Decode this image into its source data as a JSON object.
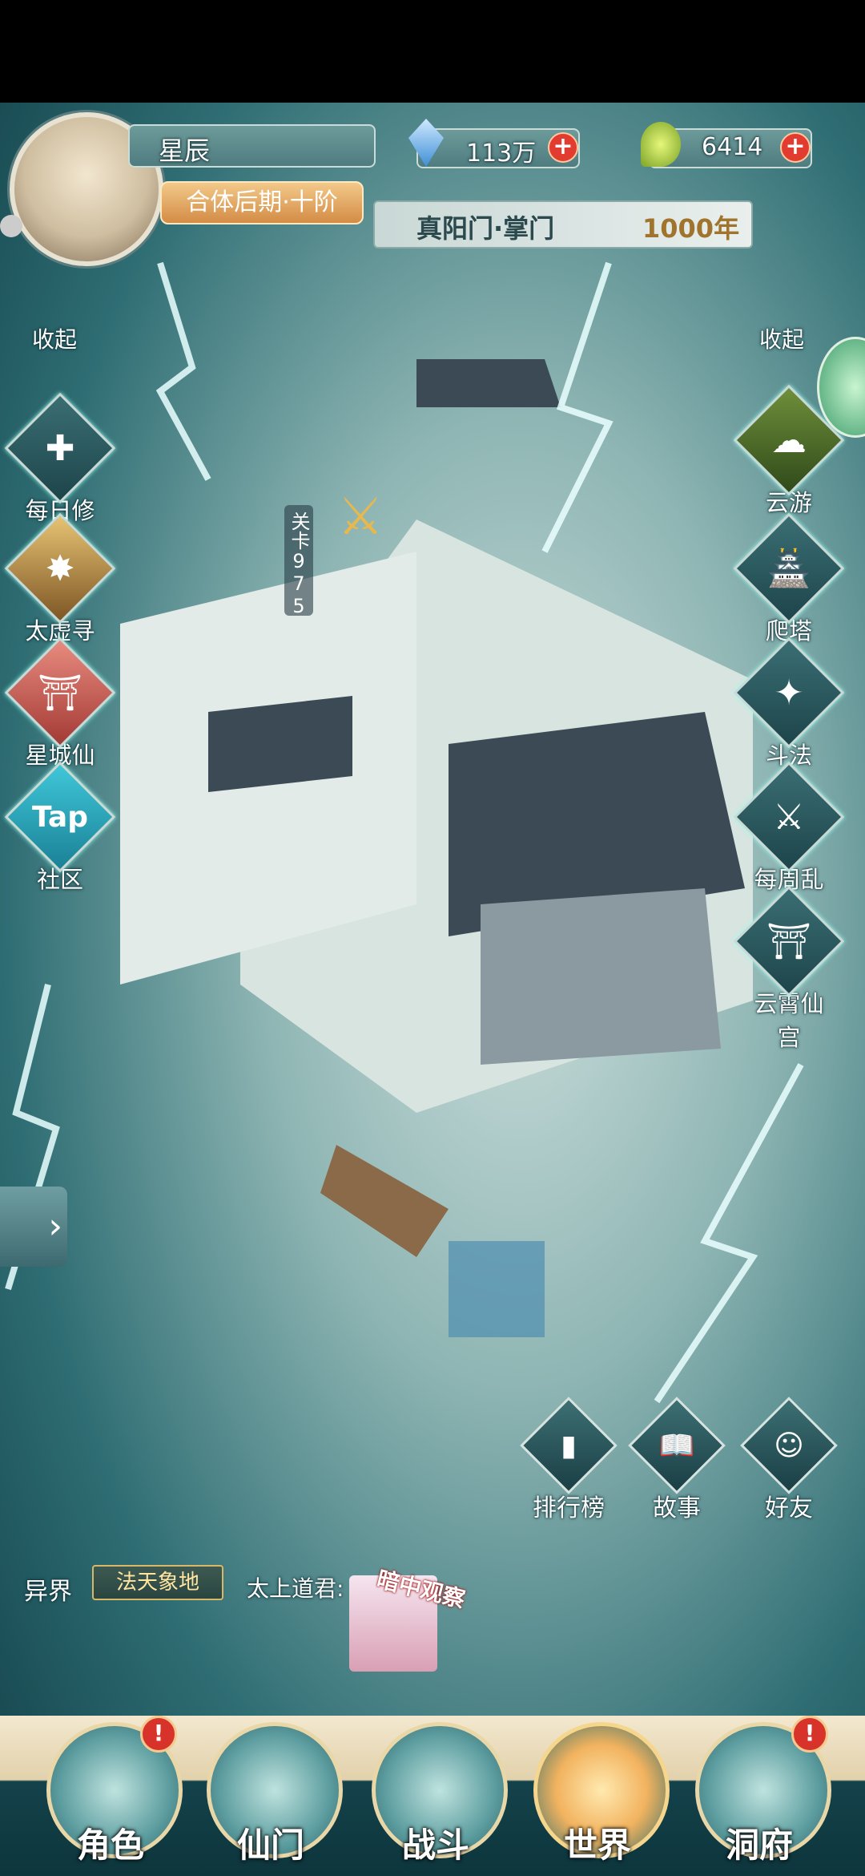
{
  "player": {
    "name": "星辰",
    "rank": "合体后期·十阶",
    "sect_title": "真阳门·掌门",
    "years": "1000年"
  },
  "resources": {
    "crystals": "113万",
    "jade": "6414"
  },
  "left_menu": {
    "collapse": "收起",
    "items": [
      {
        "label": "每日修行",
        "icon": "hammer-cross-icon"
      },
      {
        "label": "太虚寻宝",
        "icon": "treasure-burst-icon"
      },
      {
        "label": "星城仙坊",
        "icon": "pagoda-gate-icon"
      },
      {
        "label": "社区",
        "icon": "tap-logo-icon",
        "badge": "Tap"
      }
    ]
  },
  "right_menu": {
    "collapse": "收起",
    "items": [
      {
        "label": "云游",
        "icon": "cloud-icon"
      },
      {
        "label": "爬塔",
        "icon": "tower-icon"
      },
      {
        "label": "斗法",
        "icon": "claw-icon"
      },
      {
        "label": "每周乱斗",
        "icon": "battle-sword-icon"
      },
      {
        "label": "云霄仙宫",
        "icon": "palace-icon"
      }
    ]
  },
  "stage": {
    "label": "关卡",
    "number": "975"
  },
  "bottom_actions": [
    {
      "label": "排行榜",
      "icon": "ranking-bars-icon"
    },
    {
      "label": "故事",
      "icon": "book-icon"
    },
    {
      "label": "好友",
      "icon": "friends-icon"
    }
  ],
  "realm": {
    "label": "异界",
    "value": "法天象地"
  },
  "chat": {
    "speaker": "太上道君:",
    "sticker_text": "暗中观察"
  },
  "tabs": [
    {
      "label": "角色",
      "alert": "!"
    },
    {
      "label": "仙门",
      "alert": ""
    },
    {
      "label": "战斗",
      "alert": ""
    },
    {
      "label": "世界",
      "alert": ""
    },
    {
      "label": "洞府",
      "alert": "!"
    }
  ],
  "colors": {
    "accent_red": "#e23b2f",
    "gold": "#e0b26a",
    "teal": "#2e6d73"
  }
}
